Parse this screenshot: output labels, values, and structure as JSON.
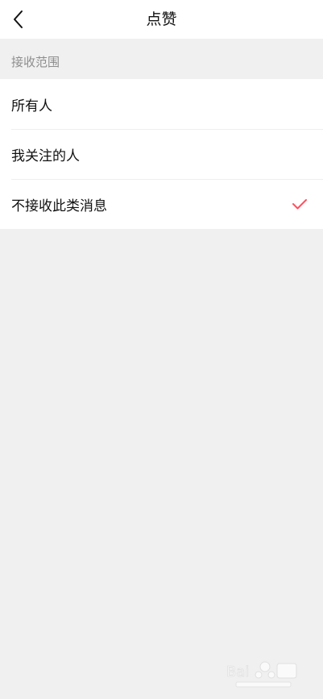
{
  "header": {
    "title": "点赞"
  },
  "section": {
    "title": "接收范围"
  },
  "options": [
    {
      "label": "所有人",
      "selected": false
    },
    {
      "label": "我关注的人",
      "selected": false
    },
    {
      "label": "不接收此类消息",
      "selected": true
    }
  ],
  "colors": {
    "accent": "#ff4f5e",
    "background": "#f0f0f0",
    "section_text": "#8e8e8e"
  },
  "icons": {
    "back": "chevron-left-icon",
    "check": "checkmark-icon"
  }
}
